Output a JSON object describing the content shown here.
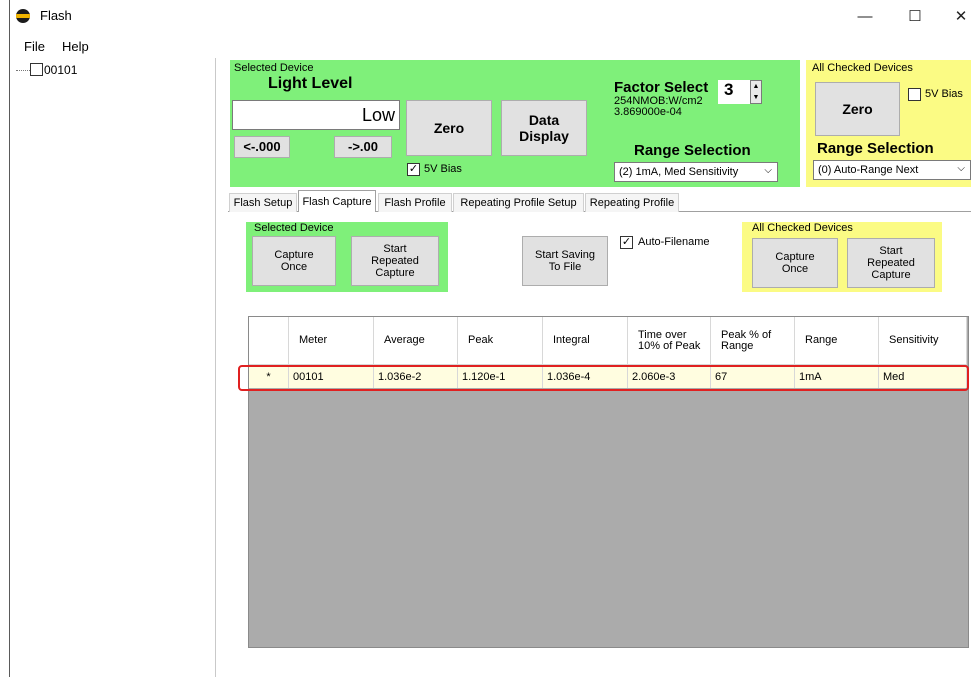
{
  "window": {
    "title": "Flash",
    "minimize": "—",
    "maximize": "☐",
    "close": "✕"
  },
  "menu": {
    "file": "File",
    "help": "Help"
  },
  "tree": {
    "device": "00101"
  },
  "selected_device": {
    "caption": "Selected Device",
    "light_level_label": "Light Level",
    "light_level_value": "Low",
    "left_button": "<-.000",
    "right_button": "->.00",
    "zero": "Zero",
    "data_display_line1": "Data",
    "data_display_line2": "Display",
    "bias_label": "5V Bias",
    "bias_checked": true,
    "factor_select_label": "Factor Select",
    "factor_value": "3",
    "factor_line1": "254NMOB:W/cm2",
    "factor_line2": "3.869000e-04",
    "range_selection_label": "Range Selection",
    "range_value": "(2) 1mA, Med Sensitivity"
  },
  "all_checked": {
    "caption": "All Checked Devices",
    "zero": "Zero",
    "bias_label": "5V Bias",
    "bias_checked": false,
    "range_selection_label": "Range Selection",
    "range_value": "(0) Auto-Range Next"
  },
  "tabs": [
    "Flash Setup",
    "Flash Capture",
    "Flash Profile",
    "Repeating Profile Setup",
    "Repeating Profile"
  ],
  "capture": {
    "selected_caption": "Selected Device",
    "capture_once_1": "Capture",
    "capture_once_2": "Once",
    "start_repeated_1": "Start",
    "start_repeated_2": "Repeated",
    "start_repeated_3": "Capture",
    "start_saving_1": "Start Saving",
    "start_saving_2": "To File",
    "auto_filename": "Auto-Filename",
    "auto_filename_checked": true,
    "all_caption": "All Checked Devices"
  },
  "table": {
    "headers": [
      "Meter",
      "Average",
      "Peak",
      "Integral",
      "Time over 10% of Peak",
      "Peak % of Range",
      "Range",
      "Sensitivity"
    ],
    "row_marker": "*",
    "row": [
      "00101",
      "1.036e-2",
      "1.120e-1",
      "1.036e-4",
      "2.060e-3",
      "67",
      "1mA",
      "Med"
    ]
  },
  "colors": {
    "green_panel": "#7ff07a",
    "yellow_panel": "#fbfb84",
    "highlight": "#e02020"
  }
}
